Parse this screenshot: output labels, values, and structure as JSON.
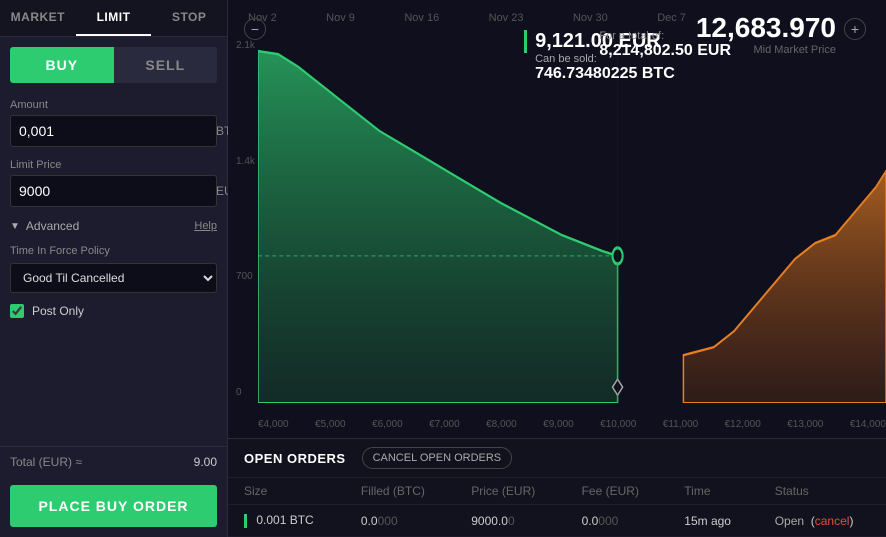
{
  "tabs": {
    "market": "MARKET",
    "limit": "LIMIT",
    "stop": "STOP",
    "active": "LIMIT"
  },
  "trade": {
    "buy_label": "BUY",
    "sell_label": "SELL",
    "amount_label": "Amount",
    "amount_value": "0,001",
    "amount_unit": "BTC",
    "limit_price_label": "Limit Price",
    "limit_price_value": "9000",
    "limit_price_unit": "EUR",
    "advanced_label": "Advanced",
    "help_label": "Help",
    "time_force_label": "Time In Force Policy",
    "time_force_value": "Good Til Cancelled",
    "post_only_label": "Post Only",
    "total_label": "Total (EUR) ≈",
    "total_value": "9.00",
    "place_order_label": "PLACE BUY ORDER"
  },
  "chart": {
    "mid_market_price": "12,683.970",
    "mid_market_label": "Mid Market Price",
    "tooltip_price": "9,121.00 EUR",
    "tooltip_can_be_sold": "Can be sold:",
    "tooltip_btc": "746.73480225 BTC",
    "for_total_label": "For a total of:",
    "for_total_value": "8,214,802.50 EUR",
    "x_labels": [
      "Nov 2",
      "Nov 9",
      "Nov 16",
      "Nov 23",
      "Nov 30",
      "Dec 7"
    ],
    "y_labels": [
      "2.1k",
      "1.4k",
      "700",
      "0"
    ],
    "x_price_labels": [
      "€4,000",
      "€5,000",
      "€6,000",
      "€7,000",
      "€8,000",
      "€9,000",
      "€10,000",
      "€11,000",
      "€12,000",
      "€13,000",
      "€14,000"
    ]
  },
  "open_orders": {
    "title": "OPEN ORDERS",
    "cancel_all_label": "CANCEL OPEN ORDERS",
    "columns": [
      "Size",
      "Filled (BTC)",
      "Price (EUR)",
      "Fee (EUR)",
      "Time",
      "Status"
    ],
    "rows": [
      {
        "size": "0.001",
        "size_unit": "BTC",
        "filled": "0.0",
        "filled_suffix": "000",
        "price": "9000.0",
        "price_suffix": "0",
        "fee": "0.0",
        "fee_suffix": "000",
        "time": "15m ago",
        "status": "Open",
        "cancel_label": "cancel"
      }
    ]
  }
}
